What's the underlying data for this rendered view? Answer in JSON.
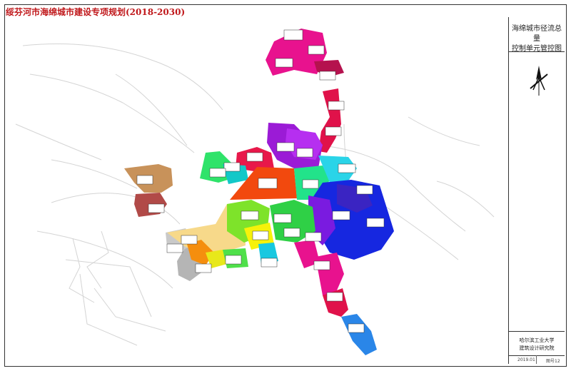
{
  "title": "绥芬河市海绵城市建设专项规划(2018-2030)",
  "sidebar": {
    "map_title_line1": "海绵城市径流总量",
    "map_title_line2": "控制单元管控图",
    "institute_line1": "哈尔滨工业大学",
    "institute_line2": "建筑设计研究院",
    "date": "2019.01",
    "figure_no": "图号12"
  },
  "colors": {
    "title": "#c0181b",
    "magenta": "#e8128e",
    "crimson": "#e0124a",
    "purple": "#9b1bd6",
    "orange_red": "#f2490e",
    "green": "#2fe36a",
    "cyan": "#2ad4e8",
    "blue": "#1627e0",
    "lime": "#7ee32a",
    "yellow": "#f6f20a",
    "tan": "#f7d98a",
    "brown": "#c8925a",
    "dark_red": "#b14a48",
    "grey": "#b5b5b5"
  },
  "icons": {
    "north_arrow": "north-arrow-icon"
  }
}
